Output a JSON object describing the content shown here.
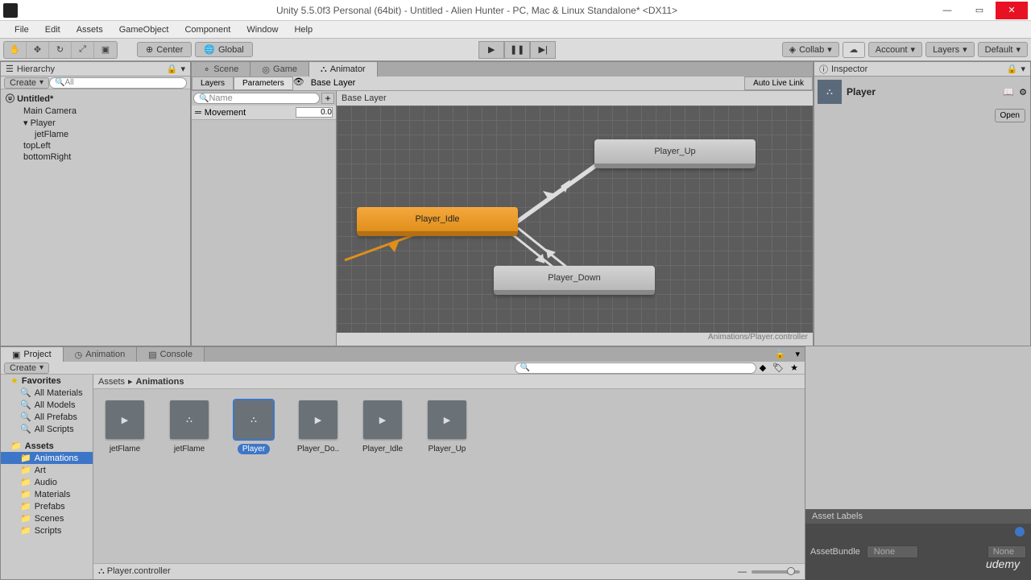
{
  "window": {
    "title": "Unity 5.5.0f3 Personal (64bit) - Untitled - Alien Hunter - PC, Mac & Linux Standalone* <DX11>"
  },
  "menu": [
    "File",
    "Edit",
    "Assets",
    "GameObject",
    "Component",
    "Window",
    "Help"
  ],
  "toolbar": {
    "center": "Center",
    "global": "Global",
    "collab": "Collab",
    "account": "Account",
    "layers": "Layers",
    "layout": "Default"
  },
  "hierarchy": {
    "title": "Hierarchy",
    "create": "Create",
    "search_placeholder": "All",
    "scene": "Untitled*",
    "items": [
      "Main Camera",
      "Player",
      "jetFlame",
      "topLeft",
      "bottomRight"
    ]
  },
  "center": {
    "tabs": {
      "scene": "Scene",
      "game": "Game",
      "animator": "Animator"
    },
    "layers": "Layers",
    "parameters": "Parameters",
    "base_layer": "Base Layer",
    "auto_live_link": "Auto Live Link",
    "param_search": "Name",
    "param_name": "Movement",
    "param_value": "0.0",
    "nodes": {
      "up": "Player_Up",
      "idle": "Player_Idle",
      "down": "Player_Down"
    },
    "path": "Animations/Player.controller"
  },
  "inspector": {
    "title": "Inspector",
    "name": "Player",
    "open": "Open",
    "asset_labels": "Asset Labels",
    "asset_bundle": "AssetBundle",
    "none": "None"
  },
  "project": {
    "title": "Project",
    "animation_tab": "Animation",
    "console_tab": "Console",
    "create": "Create",
    "favorites": "Favorites",
    "fav_items": [
      "All Materials",
      "All Models",
      "All Prefabs",
      "All Scripts"
    ],
    "assets": "Assets",
    "folders": [
      "Animations",
      "Art",
      "Audio",
      "Materials",
      "Prefabs",
      "Scenes",
      "Scripts"
    ],
    "breadcrumb": {
      "root": "Assets",
      "current": "Animations"
    },
    "items": [
      {
        "name": "jetFlame",
        "type": "clip"
      },
      {
        "name": "jetFlame",
        "type": "controller"
      },
      {
        "name": "Player",
        "type": "controller",
        "selected": true
      },
      {
        "name": "Player_Do..",
        "type": "clip"
      },
      {
        "name": "Player_Idle",
        "type": "clip"
      },
      {
        "name": "Player_Up",
        "type": "clip"
      }
    ],
    "footer": "Player.controller"
  },
  "logo": "udemy"
}
